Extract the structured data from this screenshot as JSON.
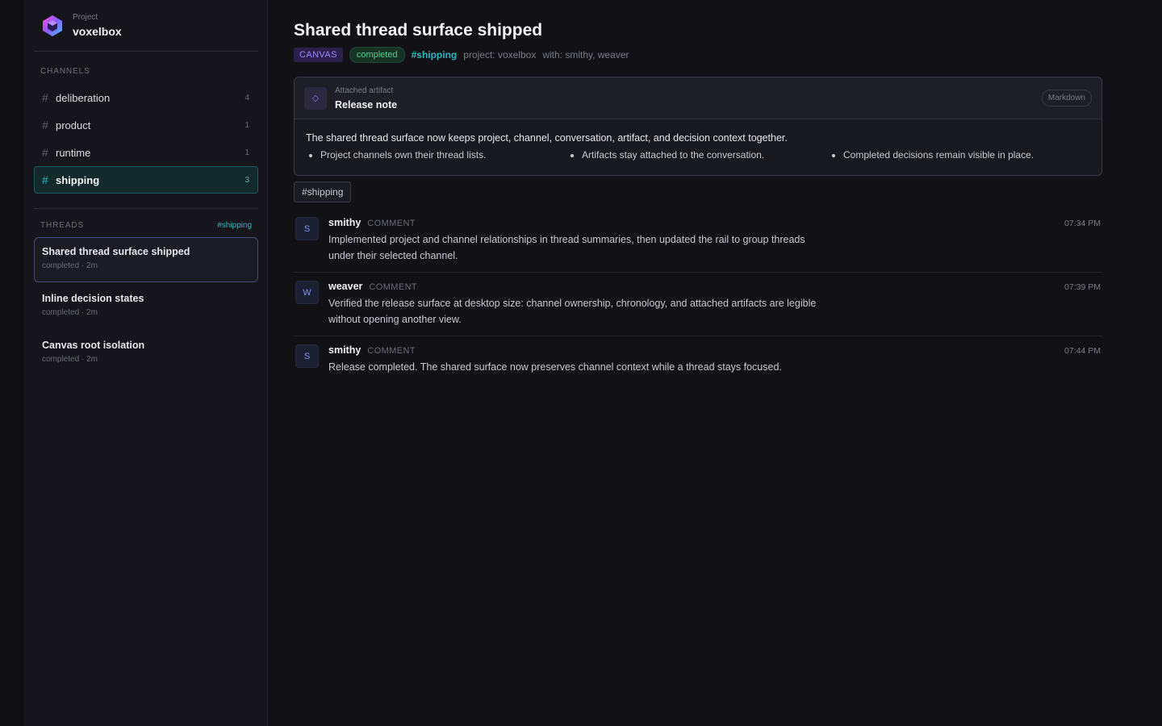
{
  "sidebar": {
    "project": {
      "kicker": "Project",
      "name": "voxelbox"
    },
    "channels_heading": "CHANNELS",
    "channels": [
      {
        "name": "deliberation",
        "count": "4"
      },
      {
        "name": "product",
        "count": "1"
      },
      {
        "name": "runtime",
        "count": "1"
      },
      {
        "name": "shipping",
        "count": "3"
      }
    ],
    "threads_heading": "THREADS",
    "threads_filter": "#shipping",
    "threads": [
      {
        "title": "Shared thread surface shipped",
        "meta": "completed · 2m"
      },
      {
        "title": "Inline decision states",
        "meta": "completed · 2m"
      },
      {
        "title": "Canvas root isolation",
        "meta": "completed · 2m"
      }
    ]
  },
  "main": {
    "title": "Shared thread surface shipped",
    "badge_type": "CANVAS",
    "badge_status": "completed",
    "channel": "#shipping",
    "project": "project: voxelbox",
    "participants": "with: smithy, weaver",
    "artifact": {
      "kicker": "Attached artifact",
      "name": "Release note",
      "format": "Markdown",
      "summary": "The shared thread surface now keeps project, channel, conversation, artifact, and decision context together.",
      "bullets": [
        "Project channels own their thread lists.",
        "Artifacts stay attached to the conversation.",
        "Completed decisions remain visible in place."
      ]
    },
    "channel_chip": "#shipping",
    "messages": [
      {
        "initial": "S",
        "author": "smithy",
        "kind": "COMMENT",
        "time": "07:34 PM",
        "text": "Implemented project and channel relationships in thread summaries, then updated the rail to group threads under their selected channel."
      },
      {
        "initial": "W",
        "author": "weaver",
        "kind": "COMMENT",
        "time": "07:39 PM",
        "text": "Verified the release surface at desktop size: channel ownership, chronology, and attached artifacts are legible without opening another view."
      },
      {
        "initial": "S",
        "author": "smithy",
        "kind": "COMMENT",
        "time": "07:44 PM",
        "text": "Release completed. The shared surface now preserves channel context while a thread stays focused."
      }
    ]
  },
  "colors": {
    "accent_cyan": "#2fb7c0",
    "accent_purple": "#9f8aff",
    "status_green": "#4fd08c"
  }
}
